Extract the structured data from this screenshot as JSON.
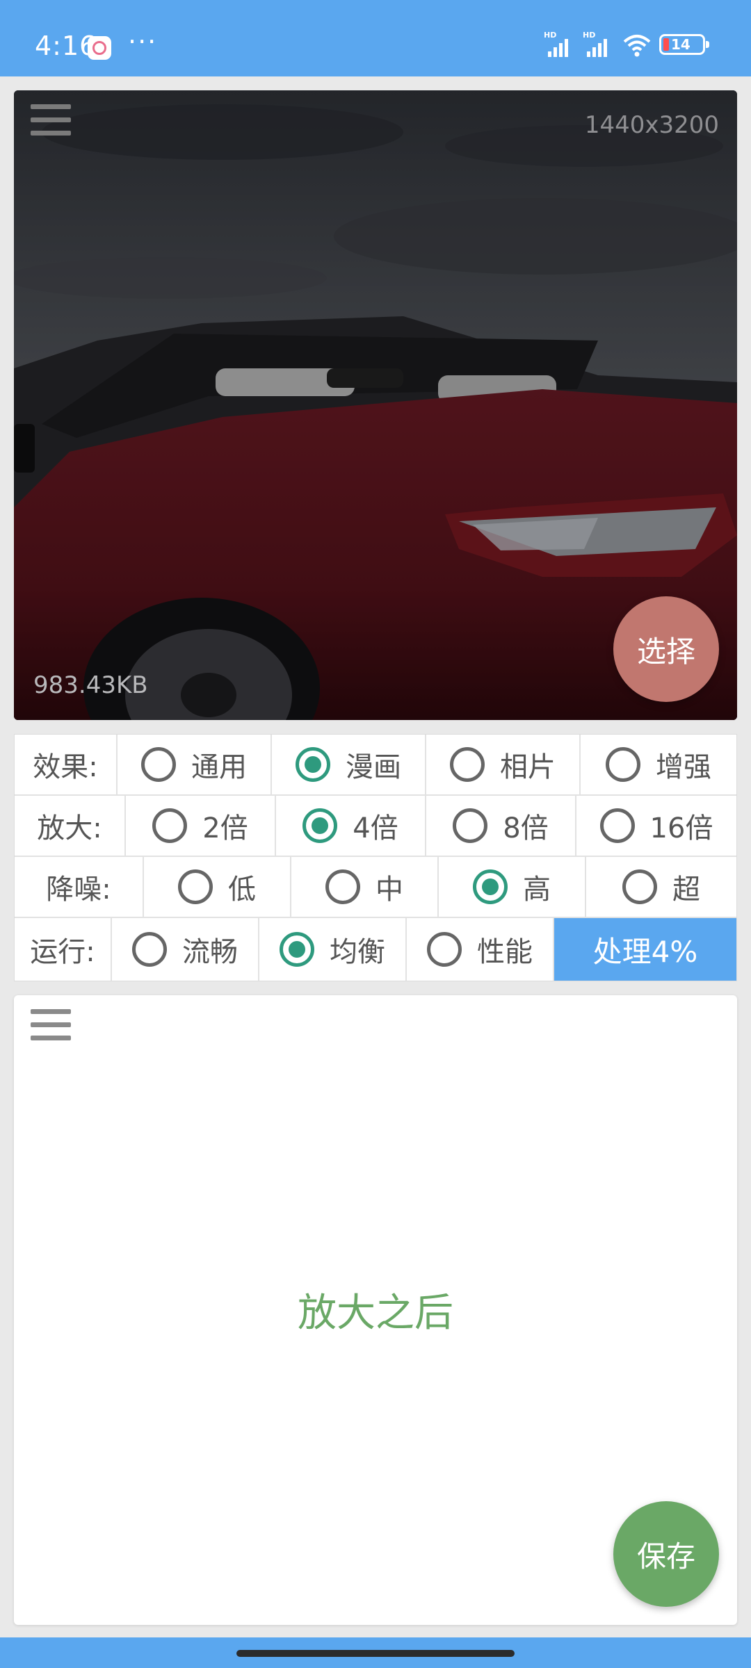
{
  "status_bar": {
    "time": "4:16",
    "overflow": "···",
    "signal1_label": "HD",
    "signal2_label": "HD",
    "battery": "14"
  },
  "image_panel": {
    "resolution": "1440x3200",
    "file_size": "983.43KB",
    "select_label": "选择"
  },
  "options": {
    "effect": {
      "label": "效果:",
      "items": [
        {
          "label": "通用",
          "checked": false
        },
        {
          "label": "漫画",
          "checked": true
        },
        {
          "label": "相片",
          "checked": false
        },
        {
          "label": "增强",
          "checked": false
        }
      ]
    },
    "scale": {
      "label": "放大:",
      "items": [
        {
          "label": "2倍",
          "checked": false
        },
        {
          "label": "4倍",
          "checked": true
        },
        {
          "label": "8倍",
          "checked": false
        },
        {
          "label": "16倍",
          "checked": false
        }
      ]
    },
    "denoise": {
      "label": "降噪:",
      "items": [
        {
          "label": "低",
          "checked": false
        },
        {
          "label": "中",
          "checked": false
        },
        {
          "label": "高",
          "checked": true
        },
        {
          "label": "超",
          "checked": false
        }
      ]
    },
    "run": {
      "label": "运行:",
      "items": [
        {
          "label": "流畅",
          "checked": false
        },
        {
          "label": "均衡",
          "checked": true
        },
        {
          "label": "性能",
          "checked": false
        }
      ],
      "process_label": "处理4%"
    }
  },
  "result_panel": {
    "placeholder": "放大之后",
    "save_label": "保存"
  },
  "colors": {
    "accent": "#5aa7ef",
    "radio_checked": "#2e9a7e",
    "select_fab": "#c1776f",
    "save_fab": "#6aa866"
  }
}
